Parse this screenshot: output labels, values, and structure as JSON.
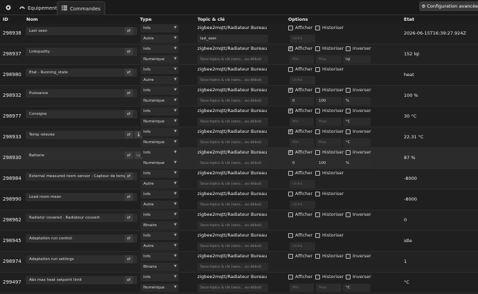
{
  "tabs": {
    "home_icon": "home-icon",
    "equipement": "Equipement",
    "commandes": "Commandes"
  },
  "config_button": "Configuration avancée",
  "columns": {
    "id": "ID",
    "nom": "Nom",
    "type": "Type",
    "topic": "Topic & clé",
    "options": "Options",
    "etat": "Etat"
  },
  "labels": {
    "afficher": "Afficher",
    "historiser": "Historiser",
    "inverser": "Inverser",
    "subtopic_placeholder": "Sous-topics & clé (sans... au début)",
    "unite": "Unité",
    "min": "Min",
    "max": "Max"
  },
  "rows": [
    {
      "id": "298938",
      "name": "Last seen",
      "type": "Info",
      "subtype": "Autre",
      "topic": "zigbee2mqtt/Radiateur Bureau",
      "subtopic": "last_seen",
      "afficher": false,
      "historiser": false,
      "unit": "",
      "state": "2026-06-15T16:39:27.924Z"
    },
    {
      "id": "298937",
      "name": "Linkquality",
      "type": "Info",
      "subtype": "Numérique",
      "topic": "zigbee2mqtt/Radiateur Bureau",
      "subtopic": "",
      "afficher": true,
      "historiser": false,
      "inverser": false,
      "min": "",
      "max": "",
      "unit": "lqi",
      "state": "152 lqi"
    },
    {
      "id": "298980",
      "name": "Etat - Running_state",
      "type": "Info",
      "subtype": "Autre",
      "topic": "zigbee2mqtt/Radiateur Bureau",
      "subtopic": "",
      "afficher": false,
      "historiser": false,
      "unit": "",
      "state": "heat"
    },
    {
      "id": "298932",
      "name": "Puissance",
      "type": "Info",
      "subtype": "Numérique",
      "topic": "zigbee2mqtt/Radiateur Bureau",
      "subtopic": "",
      "afficher": true,
      "historiser": false,
      "inverser": false,
      "min": "0",
      "max": "100",
      "unit": "%",
      "state": "100 %"
    },
    {
      "id": "298977",
      "name": "Consigne",
      "type": "Info",
      "subtype": "Numérique",
      "topic": "zigbee2mqtt/Radiateur Bureau",
      "subtopic": "",
      "afficher": true,
      "historiser": false,
      "inverser": false,
      "min": "",
      "max": "",
      "unit": "°C",
      "state": "30 °C"
    },
    {
      "id": "298933",
      "name": "Temp relevée",
      "type": "Info",
      "subtype": "Numérique",
      "topic": "zigbee2mqtt/Radiateur Bureau",
      "subtopic": "",
      "afficher": true,
      "historiser": false,
      "inverser": false,
      "min": "",
      "max": "",
      "unit": "°C",
      "state": "22.31 °C"
    },
    {
      "id": "298930",
      "name": "Batterie",
      "type": "Info",
      "subtype": "Numérique",
      "topic": "zigbee2mqtt/Radiateur Bureau",
      "subtopic": "",
      "afficher": true,
      "historiser": false,
      "inverser": false,
      "min": "0",
      "max": "100",
      "unit": "%",
      "state": "87 %"
    },
    {
      "id": "298984",
      "name": "External measured room sensor - Capteur de tempéra",
      "type": "Info",
      "subtype": "Autre",
      "topic": "zigbee2mqtt/Radiateur Bureau",
      "subtopic": "",
      "afficher": false,
      "historiser": false,
      "unit": "",
      "state": "-8000"
    },
    {
      "id": "298990",
      "name": "Load room mean",
      "type": "Info",
      "subtype": "Autre",
      "topic": "zigbee2mqtt/Radiateur Bureau",
      "subtopic": "",
      "afficher": false,
      "historiser": false,
      "unit": "",
      "state": "-8000"
    },
    {
      "id": "298962",
      "name": "Radiator covered - Radiateur couvert",
      "type": "Info",
      "subtype": "Binaire",
      "topic": "zigbee2mqtt/Radiateur Bureau",
      "subtopic": "",
      "afficher": false,
      "historiser": false,
      "inverser": false,
      "state": "0"
    },
    {
      "id": "298945",
      "name": "Adaptation run control",
      "type": "Info",
      "subtype": "Autre",
      "topic": "zigbee2mqtt/Radiateur Bureau",
      "subtopic": "",
      "afficher": false,
      "historiser": false,
      "unit": "",
      "state": "idle"
    },
    {
      "id": "298974",
      "name": "Adaptation run settings",
      "type": "Info",
      "subtype": "Binaire",
      "topic": "zigbee2mqtt/Radiateur Bureau",
      "subtopic": "",
      "afficher": false,
      "historiser": false,
      "inverser": false,
      "state": "1"
    },
    {
      "id": "299497",
      "name": "Abs max heat setpoint limit",
      "type": "Info",
      "subtype": "Numérique",
      "topic": "zigbee2mqtt/Radiateur Bureau",
      "subtopic": "",
      "afficher": false,
      "historiser": false,
      "inverser": false,
      "min": "",
      "max": "",
      "unit": "°C",
      "state": "°C"
    }
  ]
}
